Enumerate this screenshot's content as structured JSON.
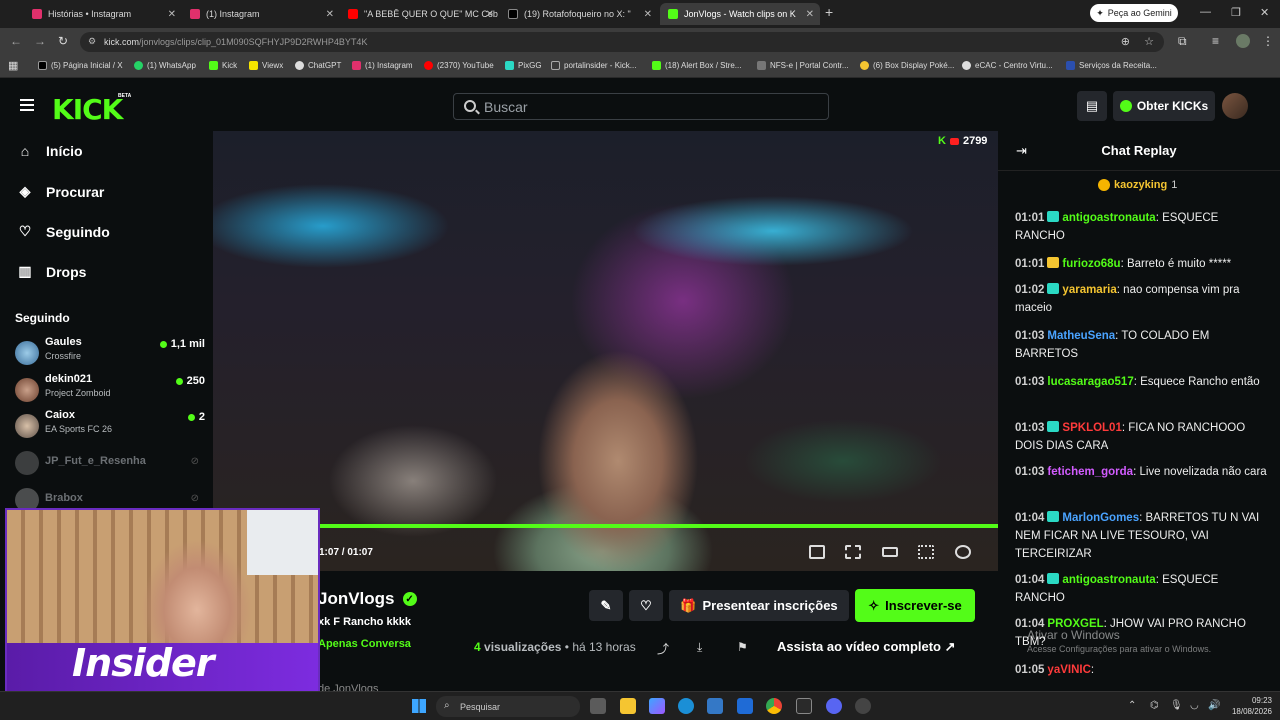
{
  "browser": {
    "tabs": [
      {
        "label": "Histórias • Instagram",
        "color": "#e1306c"
      },
      {
        "label": "(1) Instagram",
        "color": "#e1306c"
      },
      {
        "label": "\"A BEBÊ QUER O QUE\" MC Ceb",
        "color": "#ff0000"
      },
      {
        "label": "(19) Rotafofoqueiro no X: \"",
        "color": "#000000"
      },
      {
        "label": "JonVlogs - Watch clips on K",
        "color": "#53fc18"
      }
    ],
    "gemini_label": "Peça ao Gemini",
    "url_host": "kick.com",
    "url_path": "/jonvlogs/clips/clip_01M090SQFHYJP9D2RWHP4BYT4K",
    "bookmarks": [
      "(5) Página Inicial / X",
      "(1) WhatsApp",
      "Kick",
      "Viewx",
      "ChatGPT",
      "(1) Instagram",
      "(2370) YouTube",
      "PixGG",
      "portalinsider - Kick...",
      "(18) Alert Box / Stre...",
      "NFS-e | Portal Contr...",
      "(6) Box Display Poké...",
      "eCAC - Centro Virtu...",
      "Serviços da Receita..."
    ]
  },
  "header": {
    "logo": "KICK",
    "beta": "BETA",
    "search_placeholder": "Buscar",
    "kicks_label": "Obter KICKs"
  },
  "sidebar": {
    "nav": [
      {
        "label": "Início",
        "icon": "home-icon"
      },
      {
        "label": "Procurar",
        "icon": "compass-icon"
      },
      {
        "label": "Seguindo",
        "icon": "heart-icon"
      },
      {
        "label": "Drops",
        "icon": "drops-icon"
      }
    ],
    "following_title": "Seguindo",
    "channels": [
      {
        "name": "Gaules",
        "game": "Crossfire",
        "viewers": "1,1 mil",
        "live": true
      },
      {
        "name": "dekin021",
        "game": "Project Zomboid",
        "viewers": "250",
        "live": true
      },
      {
        "name": "Caiox",
        "game": "EA Sports FC 26",
        "viewers": "2",
        "live": true
      },
      {
        "name": "JP_Fut_e_Resenha",
        "live": false
      },
      {
        "name": "Brabox",
        "live": false
      }
    ]
  },
  "video": {
    "viewer_count": "2799",
    "time": "1:07 / 01:07",
    "progress": 1.0
  },
  "clip": {
    "channel": "JonVlogs",
    "title": "xk F Rancho kkkk",
    "category": "Apenas Conversa",
    "gift_label": "Presentear inscrições",
    "subscribe_label": "Inscrever-se",
    "views_count": "4",
    "views_label": "visualizações",
    "ago": "há 13 horas",
    "watch_full": "Assista ao vídeo completo",
    "clipped_by": "de JonVlogs"
  },
  "chat": {
    "title": "Chat Replay",
    "pinned_user": "kaozyking",
    "pinned_count": "1",
    "messages": [
      {
        "time": "01:01",
        "user": "antigoastronauta",
        "color": "#53fc18",
        "badge": "#2bd9c4",
        "text": "ESQUECE RANCHO"
      },
      {
        "time": "01:01",
        "user": "furiozo68u",
        "color": "#53fc18",
        "badge": "#f5c531",
        "text": "Barreto é muito *****"
      },
      {
        "time": "01:02",
        "user": "yaramaria",
        "color": "#f5c531",
        "badge": "#2bd9c4",
        "text": "nao compensa vim pra maceio"
      },
      {
        "time": "01:03",
        "user": "MatheuSena",
        "color": "#4aa3ff",
        "badge": "",
        "text": "TO COLADO EM BARRETOS"
      },
      {
        "time": "01:03",
        "user": "lucasaragao517",
        "color": "#53fc18",
        "badge": "",
        "text": "Esquece Rancho então"
      },
      {
        "time": "01:03",
        "user": "SPKLOL01",
        "color": "#ff3b3b",
        "badge": "#2bd9c4",
        "text": "FICA NO RANCHOOO DOIS DIAS CARA"
      },
      {
        "time": "01:03",
        "user": "fetichem_gorda",
        "color": "#d25cff",
        "badge": "",
        "text": "Live novelizada não cara"
      },
      {
        "time": "01:04",
        "user": "MarlonGomes",
        "color": "#4aa3ff",
        "badge": "#2bd9c4",
        "text": "BARRETOS TU N VAI NEM FICAR NA LIVE TESOURO, VAI TERCEIRIZAR"
      },
      {
        "time": "01:04",
        "user": "antigoastronauta",
        "color": "#53fc18",
        "badge": "#2bd9c4",
        "text": "ESQUECE RANCHO"
      },
      {
        "time": "01:04",
        "user": "PROXGEL",
        "color": "#53fc18",
        "badge": "",
        "text": "JHOW VAI PRO RANCHO TBM?"
      },
      {
        "time": "01:05",
        "user": "yaVINIC",
        "color": "#ff3b3b",
        "badge": "",
        "text": ""
      }
    ]
  },
  "overlay": {
    "brand": "Insider",
    "activate_title": "Ativar o Windows",
    "activate_sub": "Acesse Configurações para ativar o Windows."
  },
  "taskbar": {
    "search_placeholder": "Pesquisar",
    "time": "09:23",
    "date": "18/08/2026"
  }
}
